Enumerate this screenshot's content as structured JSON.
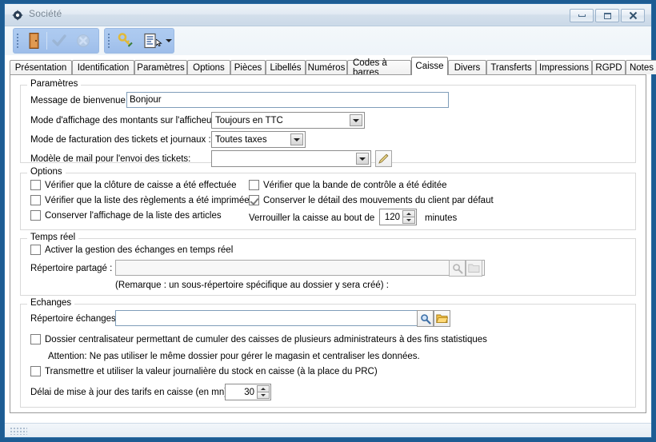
{
  "window": {
    "title": "Société",
    "icon": "app-icon",
    "buttons": {
      "minimize": "minimize",
      "maximize": "restore",
      "close": "close"
    }
  },
  "toolbar": {
    "groups": [
      {
        "items": [
          {
            "name": "exit-door-icon",
            "label": "Quitter",
            "enabled": true
          },
          {
            "name": "validate-check-icon",
            "label": "Valider",
            "enabled": false
          },
          {
            "name": "cancel-x-icon",
            "label": "Annuler",
            "enabled": false
          }
        ]
      },
      {
        "items": [
          {
            "name": "key-icon",
            "label": "Droits",
            "enabled": true
          },
          {
            "name": "list-document-icon",
            "label": "Liste",
            "enabled": true,
            "has_dropdown": true
          }
        ]
      }
    ]
  },
  "tabs": [
    {
      "label": "Présentation",
      "active": false
    },
    {
      "label": "Identification",
      "active": false
    },
    {
      "label": "Paramètres",
      "active": false
    },
    {
      "label": "Options",
      "active": false
    },
    {
      "label": "Pièces",
      "active": false
    },
    {
      "label": "Libellés",
      "active": false
    },
    {
      "label": "Numéros",
      "active": false
    },
    {
      "label": "Codes à barres",
      "active": false
    },
    {
      "label": "Caisse",
      "active": true
    },
    {
      "label": "Divers",
      "active": false
    },
    {
      "label": "Transferts",
      "active": false
    },
    {
      "label": "Impressions",
      "active": false
    },
    {
      "label": "RGPD",
      "active": false
    },
    {
      "label": "Notes",
      "active": false
    }
  ],
  "parametres": {
    "group_title": "Paramètres",
    "welcome_label": "Message de bienvenue :",
    "welcome_value": "Bonjour",
    "display_mode_label": "Mode d'affichage des montants sur l'afficheur :",
    "display_mode_value": "Toujours en TTC",
    "billing_mode_label": "Mode de facturation des tickets et journaux :",
    "billing_mode_value": "Toutes taxes",
    "mail_template_label": "Modèle de mail pour l'envoi des tickets:",
    "mail_template_value": "",
    "mail_edit_icon": "pencil-edit-icon"
  },
  "options": {
    "group_title": "Options",
    "left": [
      {
        "label": "Vérifier que la clôture de caisse a été effectuée",
        "checked": false
      },
      {
        "label": "Vérifier que la liste des règlements a été imprimée",
        "checked": false
      },
      {
        "label": "Conserver l'affichage de la liste des articles",
        "checked": false
      }
    ],
    "right": [
      {
        "label": "Vérifier que la bande de contrôle a été éditée",
        "checked": false
      },
      {
        "label": "Conserver le détail des mouvements du client par défaut",
        "checked": true
      }
    ],
    "lock_label": "Verrouiller la caisse au bout de",
    "lock_value": "120",
    "lock_unit": "minutes"
  },
  "temps_reel": {
    "group_title": "Temps réel",
    "enable_label": "Activer la gestion des échanges en temps réel",
    "enable_checked": false,
    "shared_dir_label": "Répertoire partagé :",
    "shared_dir_value": "",
    "search_icon": "magnifier-icon",
    "folder_icon": "folder-icon",
    "remark": "(Remarque : un sous-répertoire spécifique au dossier y sera créé) :"
  },
  "echanges": {
    "group_title": "Echanges",
    "dir_label": "Répertoire échanges :",
    "dir_value": "",
    "search_icon": "magnifier-icon",
    "folder_icon": "folder-icon",
    "central_label": "Dossier centralisateur permettant de cumuler des caisses de plusieurs administrateurs à des fins statistiques",
    "central_checked": false,
    "warning": "Attention: Ne pas utiliser le même dossier pour gérer le magasin et centraliser les données.",
    "stock_label": "Transmettre et utiliser la valeur journalière du stock en caisse (à la place du PRC)",
    "stock_checked": false,
    "delay_label": "Délai de mise à jour des tarifs en caisse (en mn):",
    "delay_value": "30"
  },
  "colors": {
    "frame": "#1d5c93",
    "titlebar_light": "#eef3f8",
    "toolbar_group": "#a8c6ee",
    "group_border": "#d9d9d9",
    "input_border": "#7f9db9",
    "folder_yellow": "#f2c14a",
    "magnifier_blue": "#6fa0d8"
  }
}
